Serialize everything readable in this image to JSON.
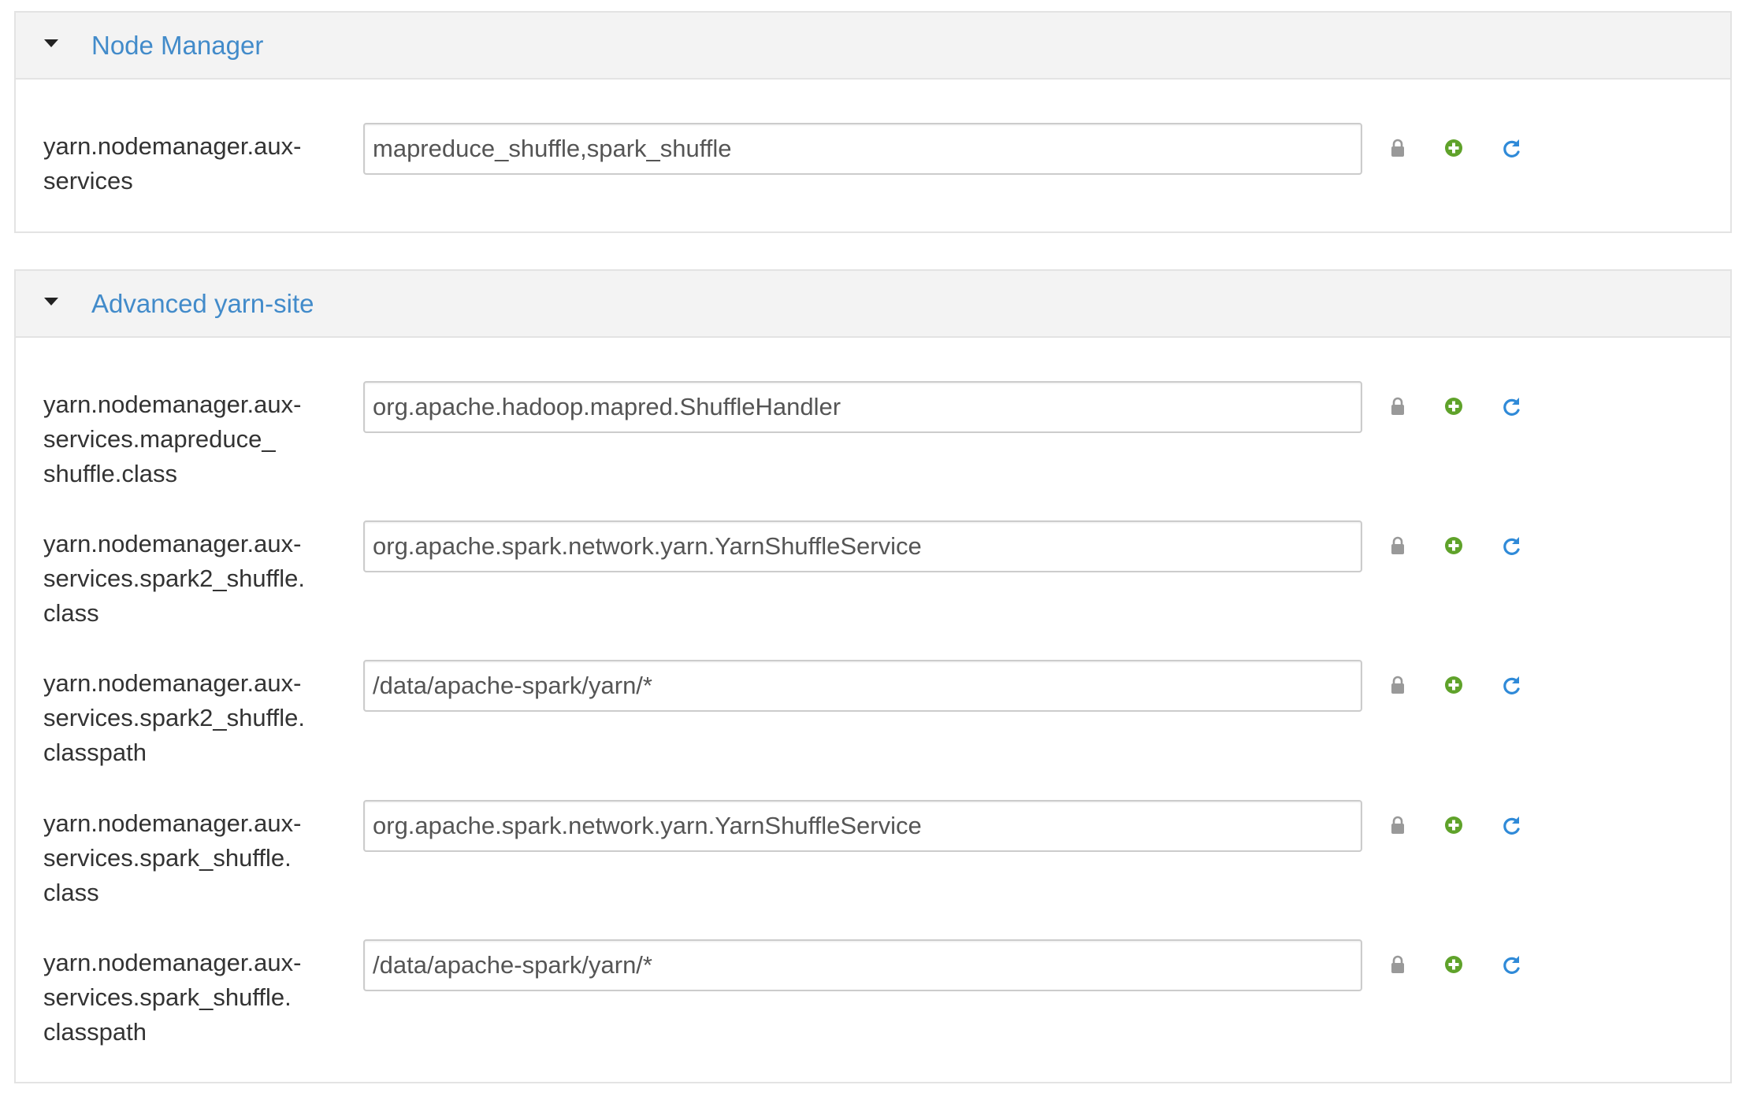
{
  "sections": [
    {
      "title": "Node Manager",
      "properties": [
        {
          "label": "yarn.nodemanager.aux-\nservices",
          "value": "mapreduce_shuffle,spark_shuffle"
        }
      ]
    },
    {
      "title": "Advanced yarn-site",
      "properties": [
        {
          "label": "yarn.nodemanager.aux-\nservices.mapreduce_\nshuffle.class",
          "value": "org.apache.hadoop.mapred.ShuffleHandler"
        },
        {
          "label": "yarn.nodemanager.aux-\nservices.spark2_shuffle.\nclass",
          "value": "org.apache.spark.network.yarn.YarnShuffleService"
        },
        {
          "label": "yarn.nodemanager.aux-\nservices.spark2_shuffle.\nclasspath",
          "value": "/data/apache-spark/yarn/*"
        },
        {
          "label": "yarn.nodemanager.aux-\nservices.spark_shuffle.\nclass",
          "value": "org.apache.spark.network.yarn.YarnShuffleService"
        },
        {
          "label": "yarn.nodemanager.aux-\nservices.spark_shuffle.\nclasspath",
          "value": "/data/apache-spark/yarn/*"
        }
      ]
    }
  ],
  "icons": {
    "lock": "lock-icon",
    "add": "plus-circle-icon",
    "undo": "undo-icon"
  },
  "colors": {
    "title_link": "#428bca",
    "add_icon": "#5fa22a",
    "undo_icon": "#2f8ad8",
    "lock_icon": "#999999",
    "header_bg": "#f3f3f3"
  }
}
